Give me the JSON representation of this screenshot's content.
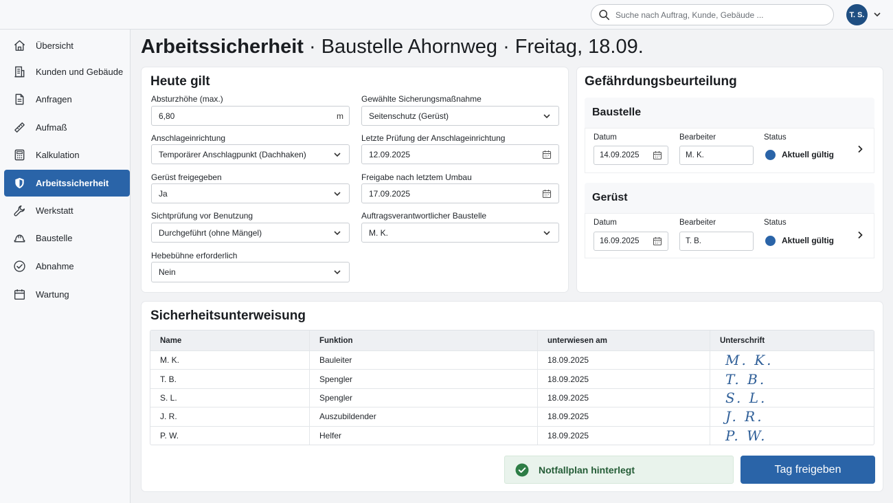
{
  "header": {
    "search_placeholder": "Suche nach Auftrag, Kunde, Gebäude ...",
    "user_initials": "T. S."
  },
  "sidebar": {
    "items": [
      {
        "label": "Übersicht",
        "icon": "home-icon"
      },
      {
        "label": "Kunden und Gebäude",
        "icon": "building-icon"
      },
      {
        "label": "Anfragen",
        "icon": "document-icon"
      },
      {
        "label": "Aufmaß",
        "icon": "ruler-icon"
      },
      {
        "label": "Kalkulation",
        "icon": "calculator-icon"
      },
      {
        "label": "Arbeitssicherheit",
        "icon": "shield-icon",
        "active": true
      },
      {
        "label": "Werkstatt",
        "icon": "wrench-icon"
      },
      {
        "label": "Baustelle",
        "icon": "helmet-icon"
      },
      {
        "label": "Abnahme",
        "icon": "check-circle-icon"
      },
      {
        "label": "Wartung",
        "icon": "calendar-icon"
      }
    ]
  },
  "page": {
    "title_strong": "Arbeitssicherheit",
    "title_rest": " · Baustelle Ahornweg · Freitag, 18.09."
  },
  "today": {
    "heading": "Heute gilt",
    "fall_height": {
      "label": "Absturzhöhe (max.)",
      "value": "6,80",
      "unit": "m"
    },
    "anchor": {
      "label": "Anschlageinrichtung",
      "value": "Temporärer Anschlagpunkt (Dachhaken)"
    },
    "scaffold": {
      "label": "Gerüst freigegeben",
      "value": "Ja"
    },
    "visual_check": {
      "label": "Sichtprüfung vor Benutzung",
      "value": "Durchgeführt (ohne Mängel)"
    },
    "lift": {
      "label": "Hebebühne erforderlich",
      "value": "Nein"
    },
    "measure": {
      "label": "Gewählte Sicherungsmaßnahme",
      "value": "Seitenschutz (Gerüst)"
    },
    "last_check": {
      "label": "Letzte Prüfung der Anschlageinrichtung",
      "value": "12.09.2025"
    },
    "release": {
      "label": "Freigabe nach letztem Umbau",
      "value": "17.09.2025"
    },
    "responsible": {
      "label": "Auftragsverantwortlicher Baustelle",
      "value": "M. K."
    }
  },
  "risk": {
    "heading": "Gefährdungsbeurteilung",
    "date_label": "Datum",
    "editor_label": "Bearbeiter",
    "status_label": "Status",
    "sections": [
      {
        "title": "Baustelle",
        "date": "14.09.2025",
        "editor": "M. K.",
        "status": "Aktuell gültig"
      },
      {
        "title": "Gerüst",
        "date": "16.09.2025",
        "editor": "T. B.",
        "status": "Aktuell gültig"
      }
    ]
  },
  "briefing": {
    "heading": "Sicherheitsunterweisung",
    "columns": [
      "Name",
      "Funktion",
      "unterwiesen am",
      "Unterschrift"
    ],
    "rows": [
      {
        "name": "M. K.",
        "role": "Bauleiter",
        "date": "18.09.2025",
        "signature": "M. K."
      },
      {
        "name": "T. B.",
        "role": "Spengler",
        "date": "18.09.2025",
        "signature": "T. B."
      },
      {
        "name": "S. L.",
        "role": "Spengler",
        "date": "18.09.2025",
        "signature": "S. L."
      },
      {
        "name": "J. R.",
        "role": "Auszubildender",
        "date": "18.09.2025",
        "signature": "J. R."
      },
      {
        "name": "P. W.",
        "role": "Helfer",
        "date": "18.09.2025",
        "signature": "P. W."
      }
    ]
  },
  "footer": {
    "notice": "Notfallplan hinterlegt",
    "approve_label": "Tag freigeben"
  },
  "colors": {
    "accent": "#2a64a8",
    "avatar": "#1f4f82",
    "success": "#2e7d46"
  }
}
